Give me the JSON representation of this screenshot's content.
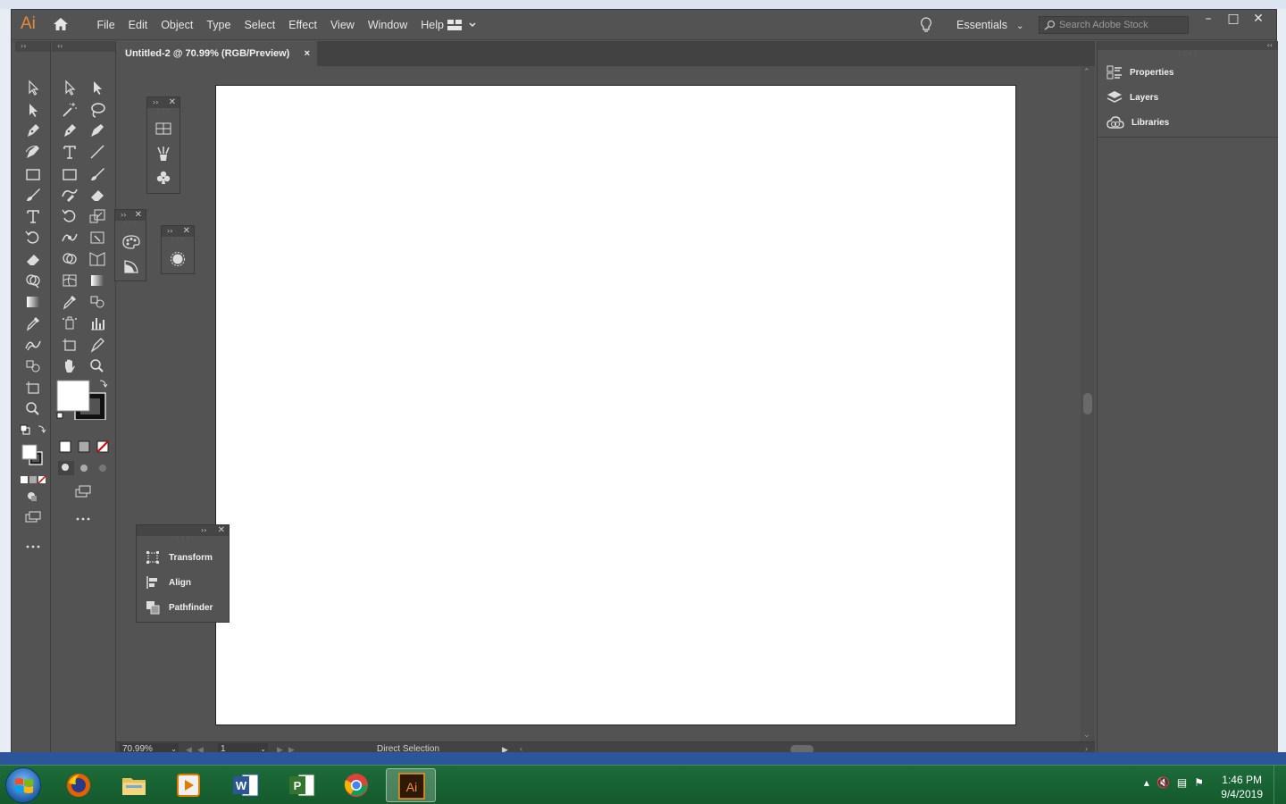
{
  "app": {
    "logo_text": "Ai",
    "menus": [
      "File",
      "Edit",
      "Object",
      "Type",
      "Select",
      "Effect",
      "View",
      "Window",
      "Help"
    ],
    "workspace_label": "Essentials",
    "search_placeholder": "Search Adobe Stock"
  },
  "document": {
    "tab_title": "Untitled-2 @ 70.99% (RGB/Preview)",
    "close_label": "×"
  },
  "statusbar": {
    "zoom": "70.99%",
    "artboard_number": "1",
    "status_text": "Direct Selection"
  },
  "right_panel": {
    "items": [
      {
        "label": "Properties",
        "icon": "properties-icon"
      },
      {
        "label": "Layers",
        "icon": "layers-icon"
      },
      {
        "label": "Libraries",
        "icon": "libraries-icon"
      }
    ]
  },
  "floating_panel": {
    "items": [
      {
        "label": "Transform",
        "icon": "transform-icon"
      },
      {
        "label": "Align",
        "icon": "align-icon"
      },
      {
        "label": "Pathfinder",
        "icon": "pathfinder-icon"
      }
    ]
  },
  "taskbar": {
    "apps": [
      "firefox",
      "file-explorer",
      "media-player",
      "word",
      "project",
      "chrome",
      "illustrator"
    ],
    "active_app": "illustrator",
    "illustrator_label": "Ai",
    "word_label": "W",
    "project_label": "P",
    "time": "1:46 PM",
    "date": "9/4/2019"
  },
  "colors": {
    "ui_bg": "#535353",
    "artboard": "#ffffff",
    "ai_orange": "#e8883a",
    "taskbar": "#1e6b3a"
  }
}
